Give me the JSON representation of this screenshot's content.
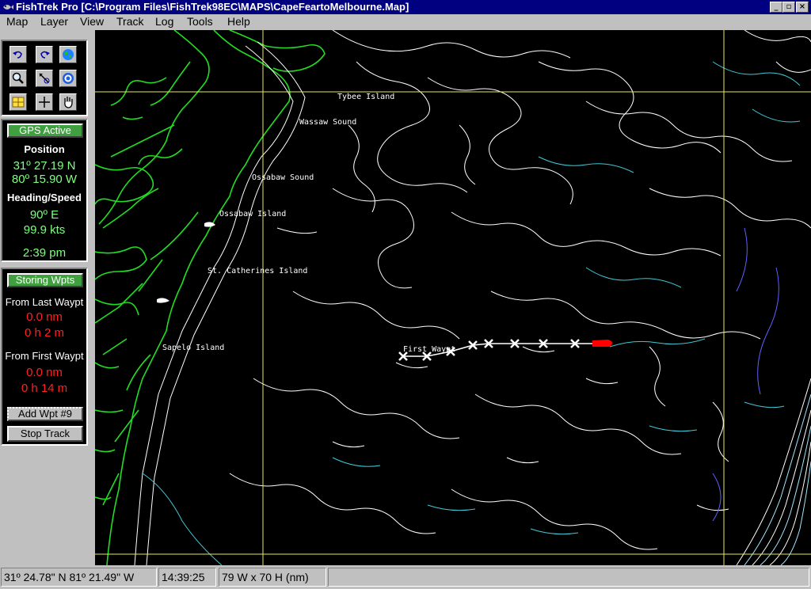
{
  "window": {
    "title": "FishTrek Pro [C:\\Program Files\\FishTrek98EC\\MAPS\\CapeFeartoMelbourne.Map]"
  },
  "menu": [
    "Map",
    "Layer",
    "View",
    "Track",
    "Log",
    "Tools",
    "Help"
  ],
  "toolbar": {
    "tools": [
      "undo-icon",
      "redo-icon",
      "globe-icon",
      "zoom-icon",
      "measure-icon",
      "target-icon",
      "grid-icon",
      "crosshair-icon",
      "hand-icon"
    ]
  },
  "gps": {
    "status_button": "GPS Active",
    "position_label": "Position",
    "lat": "31º 27.19 N",
    "lon": "80º 15.90 W",
    "heading_label": "Heading/Speed",
    "heading": "90º  E",
    "speed": "99.9 kts",
    "time": "2:39 pm"
  },
  "waypoints": {
    "status_button": "Storing Wpts",
    "from_last_label": "From Last Waypt",
    "from_last_dist": "0.0 nm",
    "from_last_time": "0 h 2 m",
    "from_first_label": "From First Waypt",
    "from_first_dist": "0.0 nm",
    "from_first_time": "0 h 14 m",
    "add_button": "Add Wpt #9",
    "stop_button": "Stop Track"
  },
  "map": {
    "labels": {
      "tybee": "Tybee Island",
      "wassaw": "Wassaw Sound",
      "ossabaw_sound": "Ossabaw Sound",
      "ossabaw_island": "Ossabaw Island",
      "st_catherines": "St. Catherines Island",
      "sapelo": "Sapelo Island",
      "first_waypt": "First Waypt"
    },
    "colors": {
      "land": "#22dd22",
      "contour": "#ffffff",
      "deep_contour": "#40c8d8",
      "offshore": "#6060ff",
      "grid": "#e8e860",
      "vessel": "#ff0000"
    }
  },
  "status": {
    "cursor_pos": "31º 24.78\" N 81º 21.49\" W",
    "clock": "14:39:25",
    "scale": "79 W x 70 H (nm)"
  }
}
